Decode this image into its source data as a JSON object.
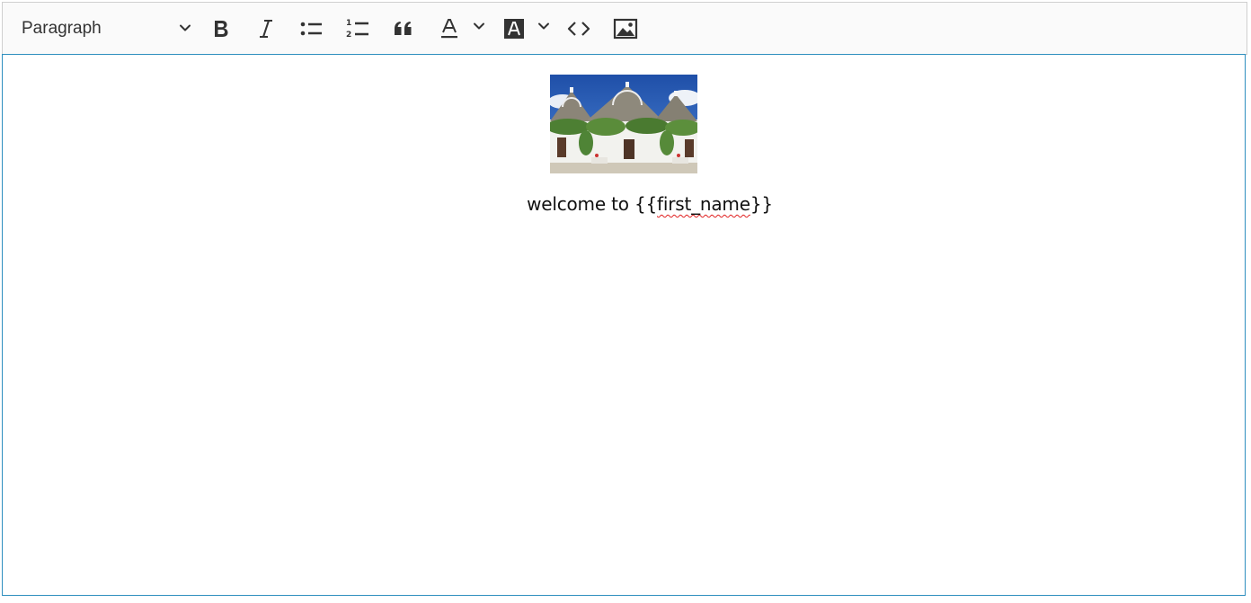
{
  "toolbar": {
    "heading_select": {
      "value": "Paragraph",
      "icon": "chevron-down-icon"
    },
    "buttons": [
      {
        "name": "bold",
        "icon": "bold-icon"
      },
      {
        "name": "italic",
        "icon": "italic-icon"
      },
      {
        "name": "bulleted-list",
        "icon": "bulleted-list-icon"
      },
      {
        "name": "numbered-list",
        "icon": "numbered-list-icon"
      },
      {
        "name": "block-quote",
        "icon": "quote-icon"
      },
      {
        "name": "font-color",
        "icon": "font-color-icon",
        "dropdown": true
      },
      {
        "name": "font-background-color",
        "icon": "font-background-color-icon",
        "dropdown": true
      },
      {
        "name": "code",
        "icon": "code-icon"
      },
      {
        "name": "insert-image",
        "icon": "image-icon"
      }
    ]
  },
  "content": {
    "image": {
      "icon": "trulli-houses-photo"
    },
    "paragraph": {
      "prefix": "welcome to ",
      "open_braces": "{{",
      "variable": "first_name",
      "close_braces": "}}"
    }
  },
  "colors": {
    "focus_border": "#2f8fbf",
    "toolbar_bg": "#fafafa",
    "spellcheck_underline": "#e02020"
  }
}
